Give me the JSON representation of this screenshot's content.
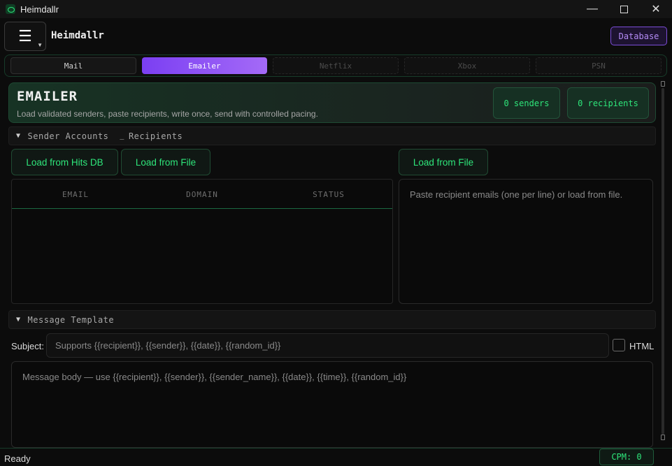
{
  "window": {
    "title": "Heimdallr"
  },
  "header": {
    "app_name": "Heimdallr",
    "database_label": "Database"
  },
  "tabs": [
    {
      "label": "Mail",
      "state": "normal"
    },
    {
      "label": "Emailer",
      "state": "active"
    },
    {
      "label": "Netflix",
      "state": "disabled"
    },
    {
      "label": "Xbox",
      "state": "disabled"
    },
    {
      "label": "PSN",
      "state": "disabled"
    }
  ],
  "hero": {
    "title": "EMAILER",
    "subtitle": "Load validated senders, paste recipients, write once, send with controlled pacing.",
    "senders_count": "0 senders",
    "recipients_count": "0 recipients"
  },
  "sections": {
    "sender_accounts": "Sender Accounts",
    "recipients": "Recipients",
    "message_template": "Message Template"
  },
  "senders": {
    "load_hits_db": "Load from Hits DB",
    "load_file": "Load from File",
    "columns": [
      "EMAIL",
      "DOMAIN",
      "STATUS"
    ]
  },
  "recipients": {
    "load_file": "Load from File",
    "placeholder": "Paste recipient emails (one per line) or load from file."
  },
  "message": {
    "subject_label": "Subject:",
    "subject_placeholder": "Supports {{recipient}}, {{sender}}, {{date}}, {{random_id}}",
    "html_label": "HTML",
    "html_checked": false,
    "body_placeholder": "Message body — use {{recipient}}, {{sender}}, {{sender_name}}, {{date}}, {{time}}, {{random_id}}"
  },
  "status": {
    "text": "Ready",
    "cpm": "CPM: 0"
  },
  "colors": {
    "accent_green": "#2ee57a",
    "accent_purple": "#7b3ff2",
    "background": "#0c0c0c"
  }
}
